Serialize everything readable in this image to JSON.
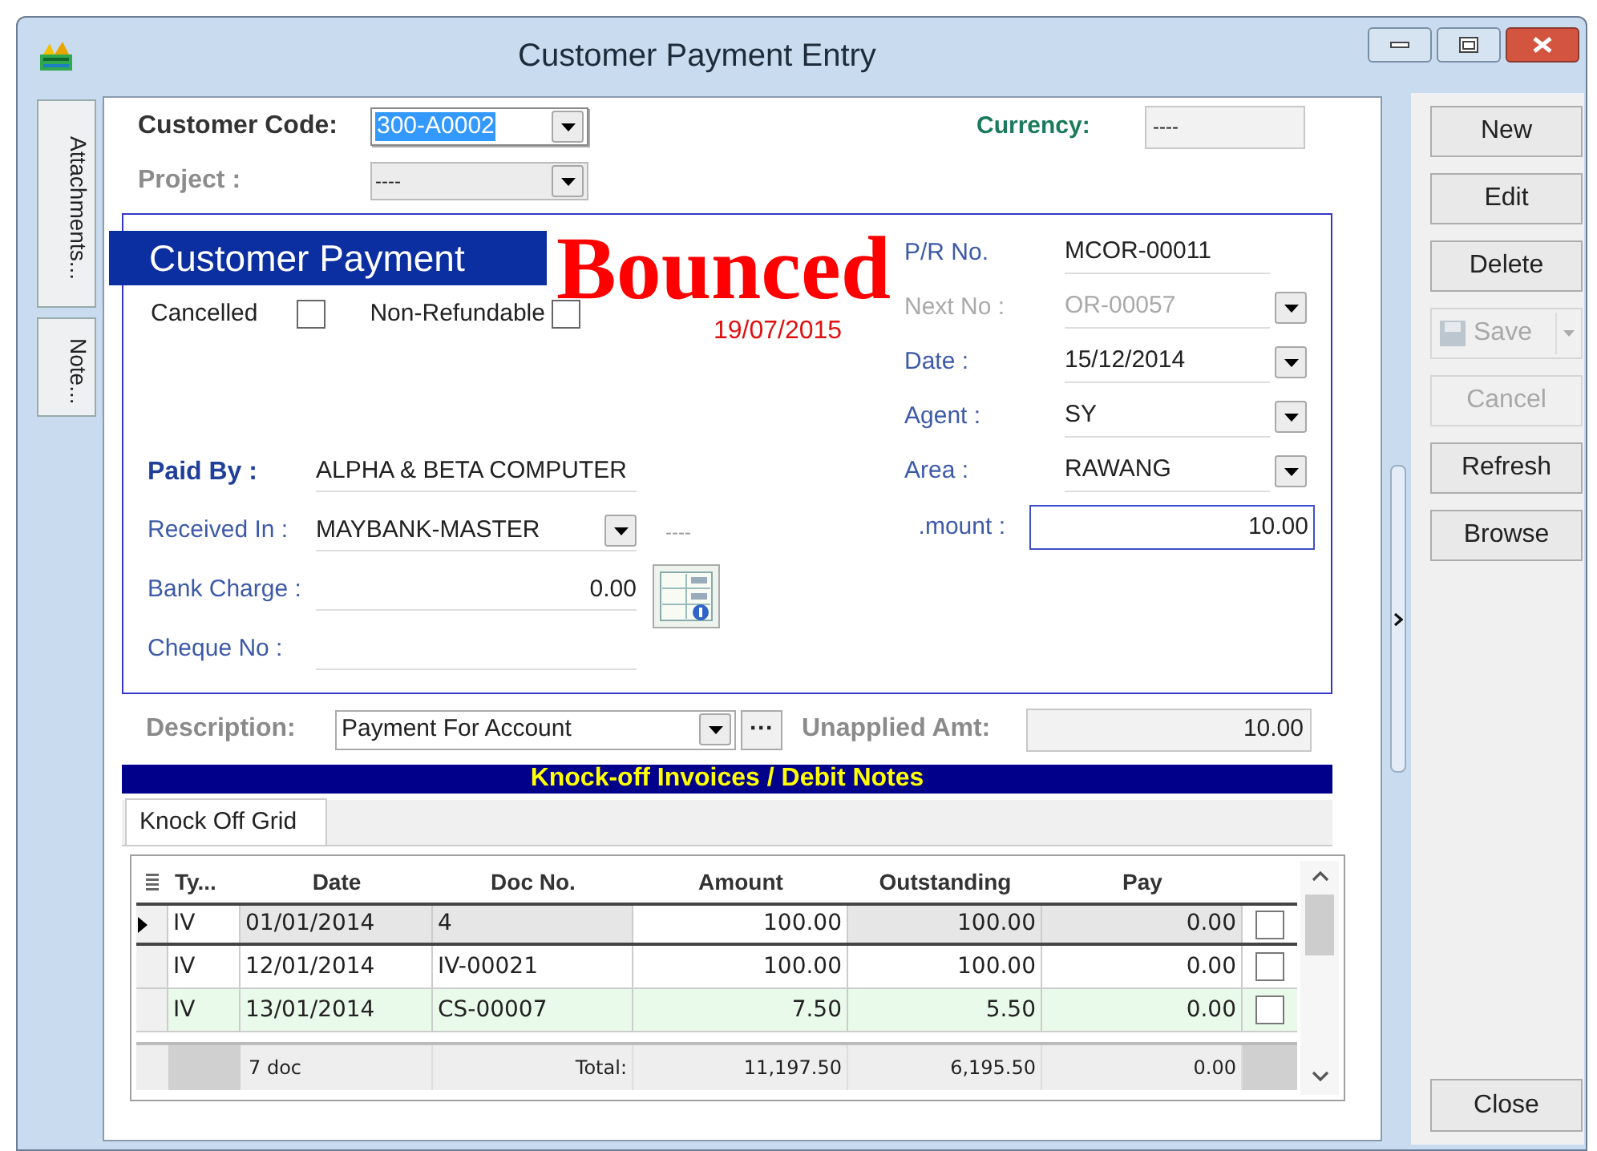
{
  "window": {
    "title": "Customer Payment Entry"
  },
  "side_tabs": [
    {
      "label": "Attachments..."
    },
    {
      "label": "Note..."
    }
  ],
  "customer_code": {
    "label": "Customer Code:",
    "value": "300-A0002",
    "value_selected": true
  },
  "project": {
    "label": "Project :",
    "value": "----",
    "disabled": true
  },
  "currency": {
    "label": "Currency:",
    "value": "----"
  },
  "payment": {
    "heading": "Customer Payment",
    "stamp": "Bounced",
    "stamp_date": "19/07/2015",
    "flags": [
      {
        "label": "Cancelled",
        "checked": false
      },
      {
        "label": "Non-Refundable",
        "checked": false
      }
    ],
    "left_fields": [
      {
        "label": "Paid By :",
        "kind": "text",
        "value": "ALPHA & BETA COMPUTER",
        "emphasis": true
      },
      {
        "label": "Received In :",
        "kind": "dropdown",
        "value": "MAYBANK-MASTER",
        "note": "----",
        "emphasis": false
      },
      {
        "label": "Bank Charge :",
        "kind": "number",
        "value": "0.00",
        "emphasis": false
      },
      {
        "label": "Cheque No :",
        "kind": "blank",
        "emphasis": false
      }
    ],
    "right_fields": [
      {
        "label": "P/R No.",
        "value": "MCOR-00011",
        "dropdown": false,
        "disabled": false
      },
      {
        "label": "Next No :",
        "value": "OR-00057",
        "dropdown": true,
        "disabled": true
      },
      {
        "label": "Date :",
        "value": "15/12/2014",
        "dropdown": true,
        "disabled": false
      },
      {
        "label": "Agent :",
        "value": "SY",
        "dropdown": true,
        "disabled": false
      },
      {
        "label": "Area :",
        "value": "RAWANG",
        "dropdown": true,
        "disabled": false
      }
    ],
    "amount": {
      "label": ".mount :",
      "value": "10.00"
    }
  },
  "description": {
    "label": "Description:",
    "value": "Payment For Account",
    "more_button": "···"
  },
  "unapplied": {
    "label": "Unapplied Amt:",
    "value": "10.00"
  },
  "knockoff": {
    "banner": "Knock-off Invoices / Debit Notes",
    "tabs": [
      {
        "label": "Knock Off Grid",
        "selected": true
      }
    ],
    "columns": [
      "Ty...",
      "Date",
      "Doc No.",
      "Amount",
      "Outstanding",
      "Pay"
    ],
    "rows": [
      {
        "type": "IV",
        "date": "01/01/2014",
        "doc_no": "4",
        "amount": "100.00",
        "outstanding": "100.00",
        "pay": "0.00",
        "checked": false,
        "selected": true,
        "highlighted": false
      },
      {
        "type": "IV",
        "date": "12/01/2014",
        "doc_no": "IV-00021",
        "amount": "100.00",
        "outstanding": "100.00",
        "pay": "0.00",
        "checked": false,
        "selected": false,
        "highlighted": false
      },
      {
        "type": "IV",
        "date": "13/01/2014",
        "doc_no": "CS-00007",
        "amount": "7.50",
        "outstanding": "5.50",
        "pay": "0.00",
        "checked": false,
        "selected": false,
        "highlighted": true
      }
    ],
    "footer": {
      "count": "7 doc",
      "label": "Total:",
      "amount": "11,197.50",
      "outstanding": "6,195.50",
      "pay": "0.00"
    }
  },
  "buttons": [
    {
      "label": "New",
      "kind": "plain",
      "disabled": false
    },
    {
      "label": "Edit",
      "kind": "plain",
      "disabled": false
    },
    {
      "label": "Delete",
      "kind": "plain",
      "disabled": false
    },
    {
      "label": "Save",
      "kind": "split",
      "disabled": true
    },
    {
      "label": "Cancel",
      "kind": "plain",
      "disabled": true
    },
    {
      "label": "Refresh",
      "kind": "plain",
      "disabled": false
    },
    {
      "label": "Browse",
      "kind": "plain",
      "disabled": false
    }
  ],
  "close_button": "Close"
}
